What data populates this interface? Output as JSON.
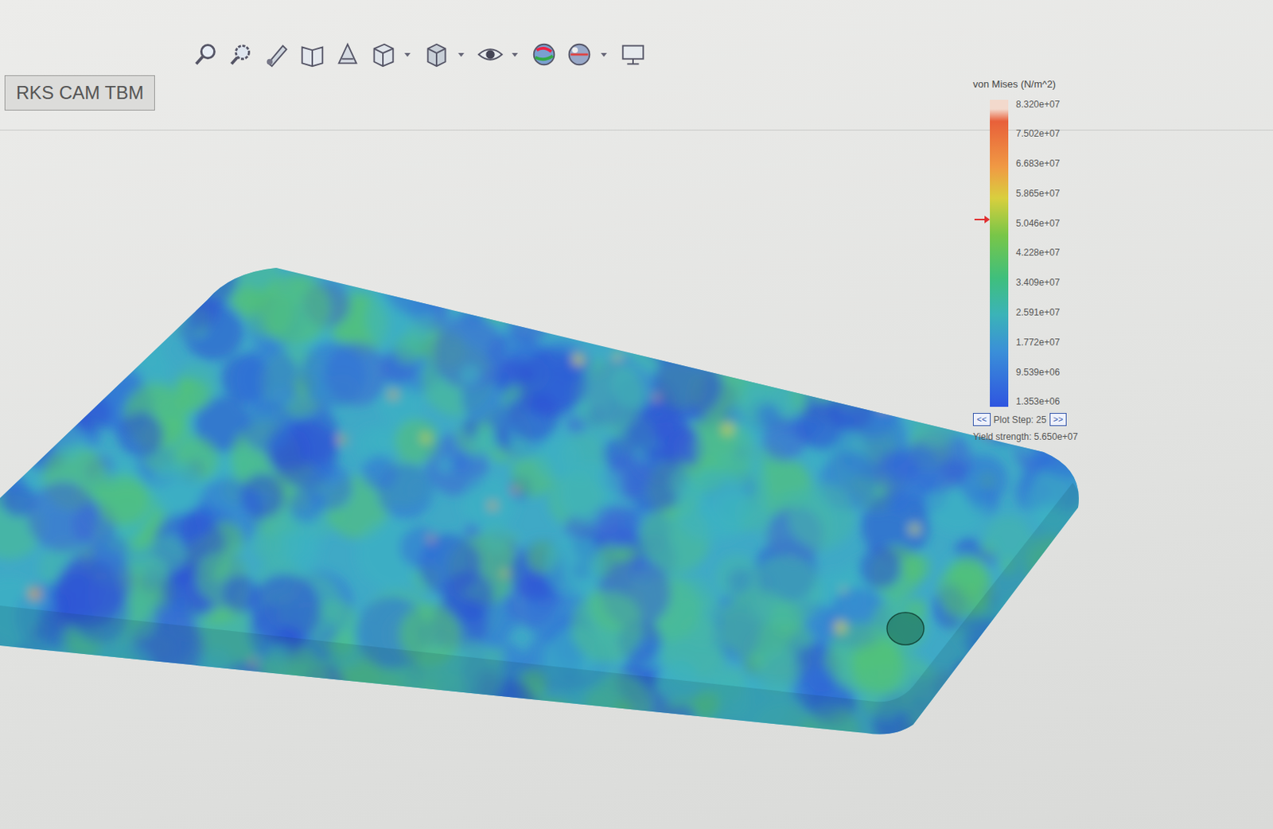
{
  "tabs": [
    {
      "label": "RKS CAM TBM",
      "selected": false
    }
  ],
  "legend": {
    "title": "von Mises (N/m^2)",
    "ticks": [
      "8.320e+07",
      "7.502e+07",
      "6.683e+07",
      "5.865e+07",
      "5.046e+07",
      "4.228e+07",
      "3.409e+07",
      "2.591e+07",
      "1.772e+07",
      "9.539e+06",
      "1.353e+06"
    ],
    "yield_marker": {
      "level": 0.61
    },
    "prev": "<<",
    "next": ">>",
    "plot_step": "Plot Step: 25",
    "yield_strength": "Yield strength: 5.650e+07"
  }
}
